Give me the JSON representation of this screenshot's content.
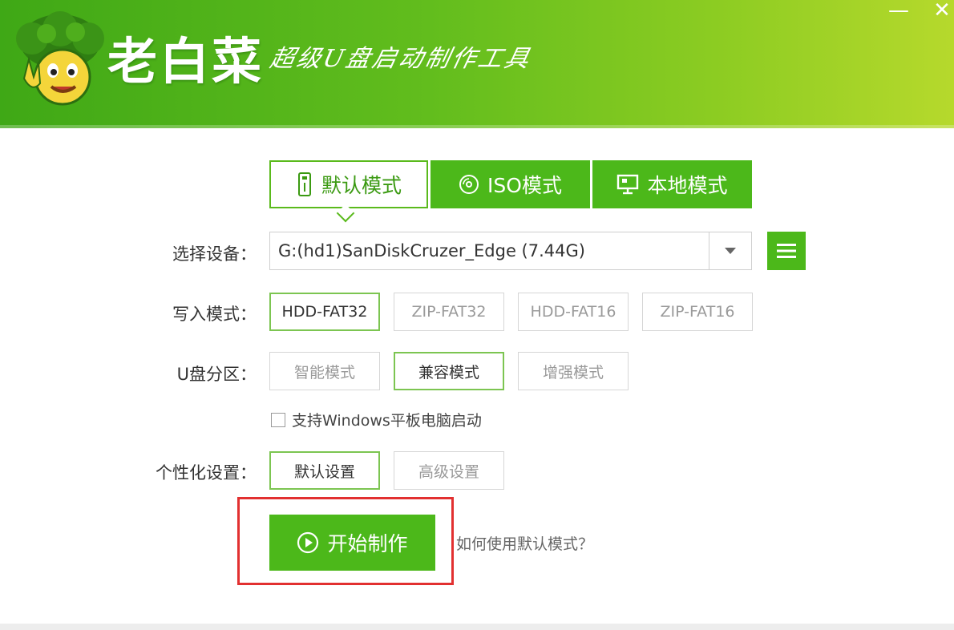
{
  "header": {
    "app_title": "老白菜",
    "slogan": "超级U盘启动制作工具",
    "minimize_symbol": "—",
    "close_symbol": "✕"
  },
  "tabs": [
    {
      "label": "默认模式",
      "icon": "usb-icon",
      "active": true
    },
    {
      "label": "ISO模式",
      "icon": "disc-icon",
      "active": false
    },
    {
      "label": "本地模式",
      "icon": "monitor-icon",
      "active": false
    }
  ],
  "device": {
    "label": "选择设备：",
    "value": "G:(hd1)SanDiskCruzer_Edge (7.44G)"
  },
  "write_mode": {
    "label": "写入模式：",
    "options": [
      "HDD-FAT32",
      "ZIP-FAT32",
      "HDD-FAT16",
      "ZIP-FAT16"
    ],
    "selected": "HDD-FAT32"
  },
  "partition": {
    "label": "U盘分区：",
    "options": [
      "智能模式",
      "兼容模式",
      "增强模式"
    ],
    "selected": "兼容模式"
  },
  "tablet_boot": {
    "label": "支持Windows平板电脑启动",
    "checked": false
  },
  "personalize": {
    "label": "个性化设置：",
    "options": [
      "默认设置",
      "高级设置"
    ],
    "selected": "默认设置"
  },
  "actions": {
    "start_label": "开始制作",
    "help_link": "如何使用默认模式？"
  },
  "colors": {
    "brand_green": "#4cb81a",
    "highlight_red": "#e23030"
  }
}
